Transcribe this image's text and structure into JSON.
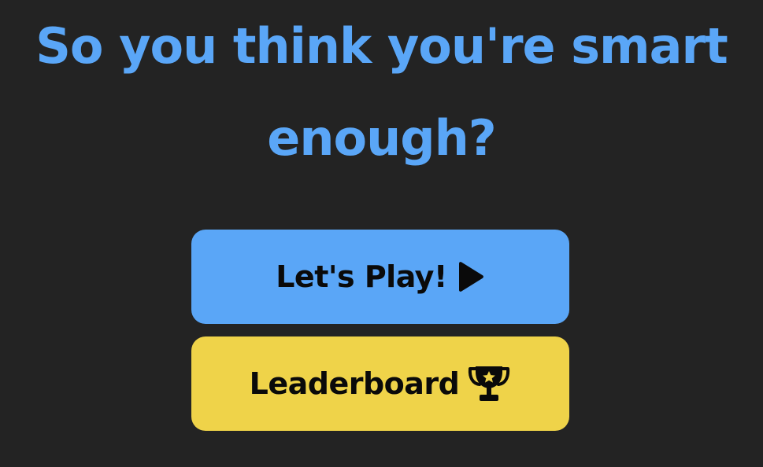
{
  "headline": {
    "line1": "So you think you're smart",
    "line2": "enough?"
  },
  "buttons": {
    "play": {
      "label": "Let's Play!",
      "icon": "play-icon"
    },
    "leaderboard": {
      "label": "Leaderboard",
      "icon": "trophy-icon"
    }
  },
  "colors": {
    "background": "#232323",
    "accent_blue": "#5aa6f7",
    "accent_yellow": "#efd349",
    "button_text": "#0a0a0a"
  }
}
